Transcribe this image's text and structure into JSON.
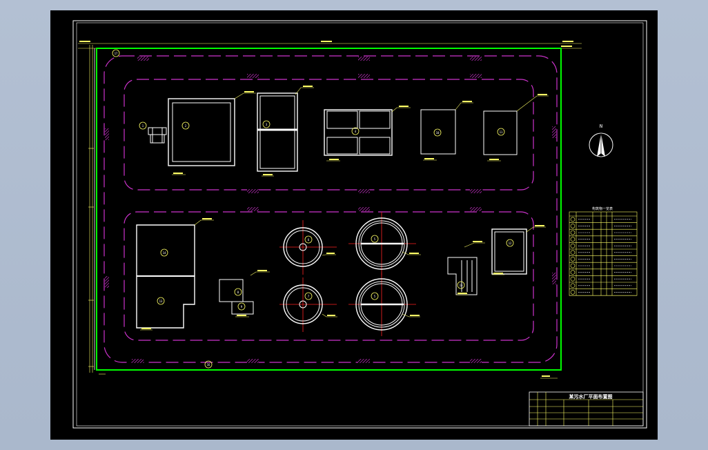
{
  "colors": {
    "frame": "#ffffff",
    "boundary": "#00ff00",
    "road": "#cc33cc",
    "hatch": "#cc33cc",
    "dimension": "#ffff66",
    "axis": "#ff2222",
    "structure": "#ffffff",
    "title_block": "#ffff66"
  },
  "north_arrow": {
    "label": "N"
  },
  "structure_tags": {
    "s1": "1",
    "s2": "2",
    "s3": "3",
    "s4": "4",
    "s5": "5",
    "s6": "10",
    "s7": "11",
    "s8": "14",
    "s9": "13",
    "s10": "6",
    "s11": "7",
    "s12": "8",
    "s13": "9",
    "s14": "12",
    "s15": "15",
    "gate": "16",
    "corner": "17"
  },
  "legend_table": {
    "title": "构筑物一览表",
    "rows": 12
  },
  "title_block": {
    "title": "某污水厂平面布置图"
  }
}
